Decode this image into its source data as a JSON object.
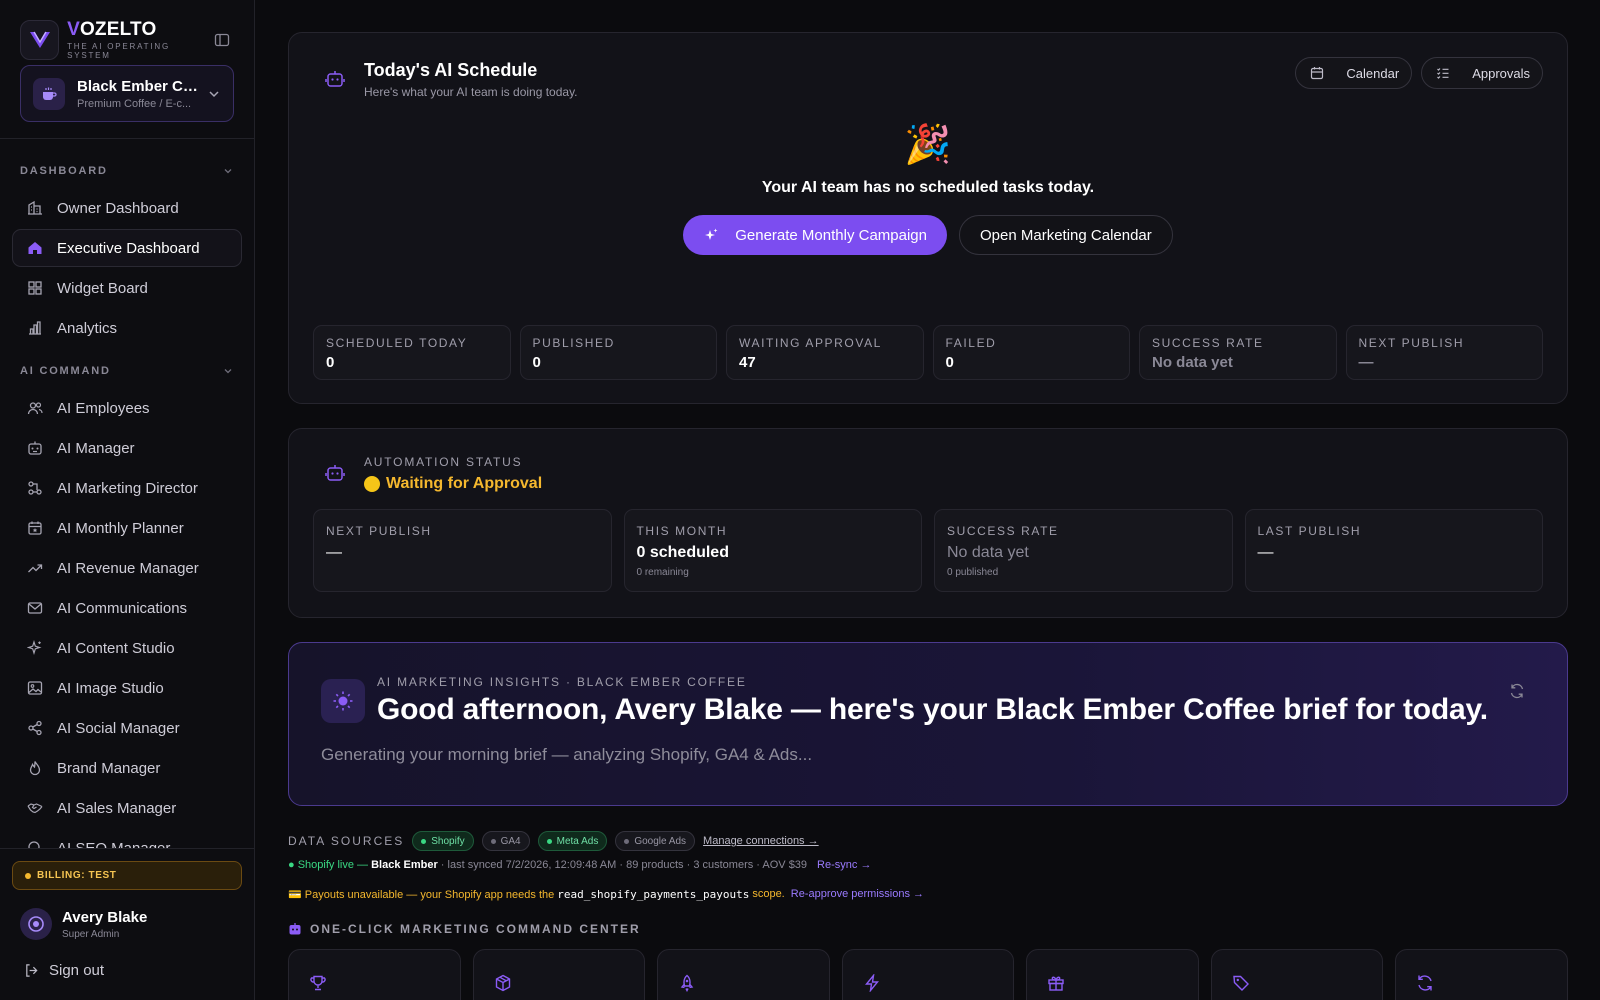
{
  "brand": {
    "letter": "V",
    "rest": "OZELTO",
    "tagline": "THE AI OPERATING SYSTEM"
  },
  "workspace": {
    "name": "Black Ember Co...",
    "subtitle": "Premium Coffee / E-c..."
  },
  "nav": {
    "sections": [
      {
        "label": "DASHBOARD",
        "items": [
          {
            "label": "Owner Dashboard",
            "icon": "building-icon"
          },
          {
            "label": "Executive Dashboard",
            "icon": "home-icon",
            "active": true
          },
          {
            "label": "Widget Board",
            "icon": "grid-icon"
          },
          {
            "label": "Analytics",
            "icon": "bar-chart-icon"
          }
        ]
      },
      {
        "label": "AI COMMAND",
        "items": [
          {
            "label": "AI Employees",
            "icon": "users-icon"
          },
          {
            "label": "AI Manager",
            "icon": "bot-icon"
          },
          {
            "label": "AI Marketing Director",
            "icon": "workflow-icon"
          },
          {
            "label": "AI Monthly Planner",
            "icon": "calendar-star-icon"
          },
          {
            "label": "AI Revenue Manager",
            "icon": "trending-up-icon"
          },
          {
            "label": "AI Communications",
            "icon": "mail-icon"
          },
          {
            "label": "AI Content Studio",
            "icon": "sparkles-icon"
          },
          {
            "label": "AI Image Studio",
            "icon": "image-icon"
          },
          {
            "label": "AI Social Manager",
            "icon": "share-icon"
          },
          {
            "label": "Brand Manager",
            "icon": "flame-icon"
          },
          {
            "label": "AI Sales Manager",
            "icon": "handshake-icon"
          },
          {
            "label": "AI SEO Manager",
            "icon": "search-icon"
          }
        ]
      }
    ]
  },
  "billing": {
    "label": "BILLING: TEST"
  },
  "user": {
    "name": "Avery Blake",
    "role": "Super Admin"
  },
  "signout": {
    "label": "Sign out"
  },
  "schedule": {
    "title": "Today's AI Schedule",
    "subtitle": "Here's what your AI team is doing today.",
    "calendar_label": "Calendar",
    "approvals_label": "Approvals",
    "emoji": "🎉",
    "empty_text": "Your AI team has no scheduled tasks today.",
    "primary_cta": "Generate Monthly Campaign",
    "secondary_cta": "Open Marketing Calendar",
    "stats": [
      {
        "label": "SCHEDULED TODAY",
        "value": "0"
      },
      {
        "label": "PUBLISHED",
        "value": "0"
      },
      {
        "label": "WAITING APPROVAL",
        "value": "47"
      },
      {
        "label": "FAILED",
        "value": "0"
      },
      {
        "label": "SUCCESS RATE",
        "value": "No data yet",
        "muted": true
      },
      {
        "label": "NEXT PUBLISH",
        "value": "—",
        "muted": true
      }
    ]
  },
  "automation": {
    "label": "AUTOMATION STATUS",
    "status": "Waiting for Approval",
    "stats": [
      {
        "label": "NEXT PUBLISH",
        "value": "—",
        "sub": ""
      },
      {
        "label": "THIS MONTH",
        "value": "0 scheduled",
        "sub": "0 remaining"
      },
      {
        "label": "SUCCESS RATE",
        "value": "No data yet",
        "sub": "0 published",
        "muted": true
      },
      {
        "label": "LAST PUBLISH",
        "value": "—",
        "sub": ""
      }
    ]
  },
  "insights": {
    "label": "AI MARKETING INSIGHTS · BLACK EMBER COFFEE",
    "title": "Good afternoon, Avery Blake — here's your Black Ember Coffee brief for today.",
    "body": "Generating your morning brief — analyzing Shopify, GA4 & Ads..."
  },
  "data_sources": {
    "label": "DATA SOURCES",
    "chips": [
      {
        "label": "Shopify",
        "live": true
      },
      {
        "label": "GA4",
        "live": false
      },
      {
        "label": "Meta Ads",
        "live": true
      },
      {
        "label": "Google Ads",
        "live": false
      }
    ],
    "manage_label": "Manage connections →",
    "sync": {
      "live_prefix": "● Shopify live —",
      "store": "Black Ember",
      "details": "· last synced 7/2/2026, 12:09:48 AM · 89 products · 3 customers · AOV $39",
      "resync": "Re-sync →"
    },
    "payout": {
      "prefix": "💳 Payouts unavailable — your Shopify app needs the",
      "scope": "read_shopify_payments_payouts",
      "suffix": "scope.",
      "link": "Re-approve permissions →"
    }
  },
  "command_center": {
    "label": "ONE-CLICK MARKETING COMMAND CENTER",
    "cards": [
      {
        "icon": "trophy-icon"
      },
      {
        "icon": "package-icon"
      },
      {
        "icon": "rocket-icon"
      },
      {
        "icon": "zap-icon"
      },
      {
        "icon": "gift-icon"
      },
      {
        "icon": "tag-icon"
      },
      {
        "icon": "refresh-icon"
      }
    ]
  },
  "colors": {
    "accent": "#7c4df0",
    "warning": "#f5b82e",
    "success": "#3ad883"
  }
}
